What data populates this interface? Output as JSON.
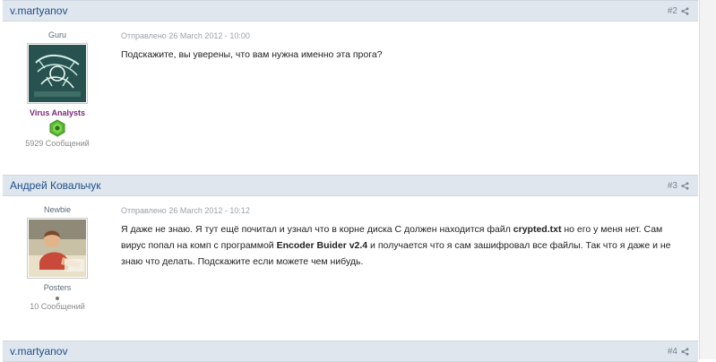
{
  "posts": [
    {
      "author": "v.martyanov",
      "number": "#2",
      "rank": "Guru",
      "group": "Virus Analysts",
      "post_count": "5929 Сообщений",
      "date": "Отправлено 26 March 2012 - 10:00",
      "text": "Подскажите, вы уверены, что вам нужна именно эта прога?"
    },
    {
      "author": "Андрей Ковальчук",
      "number": "#3",
      "rank": "Newbie",
      "group": "Posters",
      "post_count": "10 Сообщений",
      "date": "Отправлено 26 March 2012 - 10:12",
      "text_parts": [
        "Я даже не знаю. Я тут ещё почитал и узнал что в корне диска С должен находится файл ",
        "crypted.txt",
        " но его у меня нет. Сам вирус попал на комп с программой ",
        "Encoder Buider v2.4",
        " и получается что я сам зашифровал все файлы. Так что я даже и не знаю что делать. Подскажите если можете чем нибудь."
      ]
    },
    {
      "author": "v.martyanov",
      "number": "#4"
    }
  ],
  "colors": {
    "header_bg": "#dfe6ee",
    "author_link": "#1f4f89",
    "group_virus_analysts": "#7a2a7a"
  }
}
